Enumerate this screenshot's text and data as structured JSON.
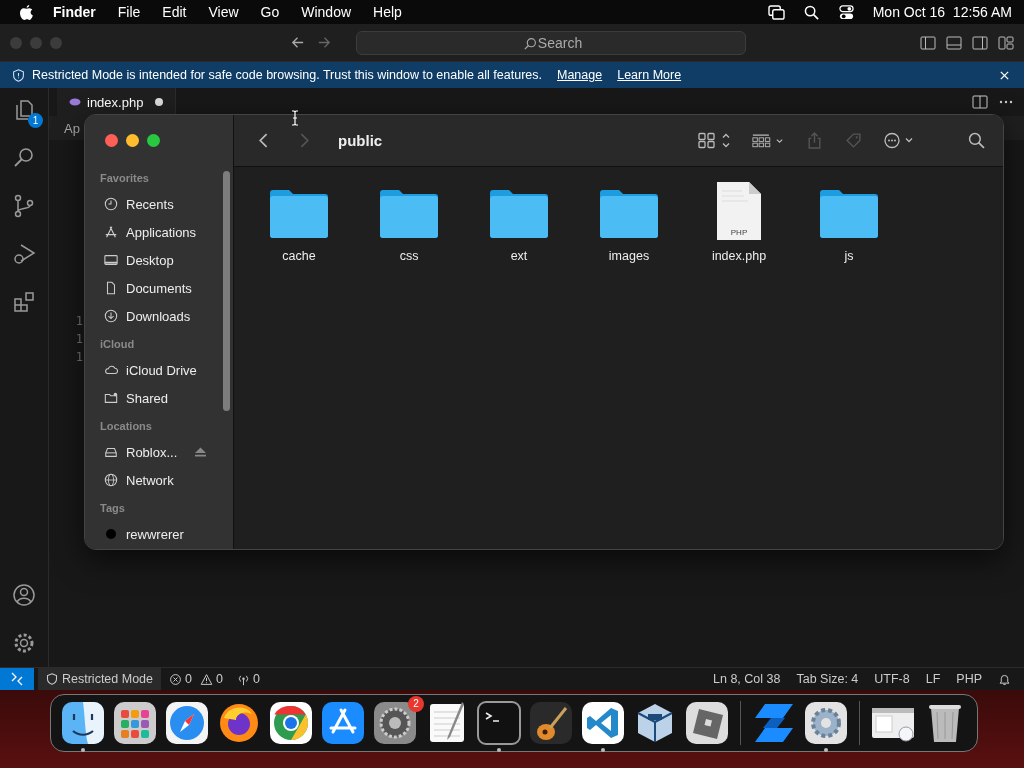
{
  "menu_bar": {
    "app_name": "Finder",
    "menus": [
      "File",
      "Edit",
      "View",
      "Go",
      "Window",
      "Help"
    ],
    "clock": "Mon Oct 16  12:56 AM"
  },
  "editor_window": {
    "search": {
      "placeholder": "Search"
    },
    "banner": {
      "message": "Restricted Mode is intended for safe code browsing. Trust this window to enable all features.",
      "links": [
        "Manage",
        "Learn More"
      ]
    },
    "explorer_badge": "1",
    "tab": {
      "label": "index.php",
      "modified": true
    },
    "editor_text": "Ap",
    "line_numbers": [
      "1",
      "1",
      "1"
    ]
  },
  "status_bar": {
    "mode": "Restricted Mode",
    "errors": "0",
    "warnings": "0",
    "ports": "0",
    "items": [
      "Ln 8, Col 38",
      "Tab Size: 4",
      "UTF-8",
      "LF",
      "PHP"
    ]
  },
  "finder": {
    "title": "public",
    "sidebar": [
      {
        "heading": "Favorites",
        "items": [
          {
            "label": "Recents",
            "kind": "recents",
            "selected": false
          },
          {
            "label": "Applications",
            "kind": "applications",
            "selected": false
          },
          {
            "label": "Desktop",
            "kind": "desktop",
            "selected": false
          },
          {
            "label": "Documents",
            "kind": "documents",
            "selected": false
          },
          {
            "label": "Downloads",
            "kind": "downloads",
            "selected": false
          }
        ]
      },
      {
        "heading": "iCloud",
        "items": [
          {
            "label": "iCloud Drive",
            "kind": "cloud",
            "selected": false
          },
          {
            "label": "Shared",
            "kind": "shared",
            "selected": false
          }
        ]
      },
      {
        "heading": "Locations",
        "items": [
          {
            "label": "Roblox...",
            "kind": "drive",
            "selected": false,
            "ejectable": true
          },
          {
            "label": "Network",
            "kind": "network",
            "selected": false
          }
        ]
      },
      {
        "heading": "Tags",
        "items": [
          {
            "label": "rewwrerer",
            "kind": "tag",
            "selected": false,
            "color": "#000000"
          }
        ]
      }
    ],
    "files": [
      {
        "name": "cache",
        "kind": "folder"
      },
      {
        "name": "css",
        "kind": "folder"
      },
      {
        "name": "ext",
        "kind": "folder"
      },
      {
        "name": "images",
        "kind": "folder"
      },
      {
        "name": "index.php",
        "kind": "php",
        "badge": "PHP"
      },
      {
        "name": "js",
        "kind": "folder"
      }
    ]
  },
  "dock": {
    "items": [
      {
        "kind": "finder",
        "running": true
      },
      {
        "kind": "launchpad",
        "running": false
      },
      {
        "kind": "safari",
        "running": false
      },
      {
        "kind": "firefox",
        "running": false
      },
      {
        "kind": "chrome",
        "running": false
      },
      {
        "kind": "appstore",
        "running": false
      },
      {
        "kind": "settings",
        "running": false,
        "badge": "2"
      },
      {
        "kind": "textedit",
        "running": false
      },
      {
        "kind": "terminal",
        "running": true
      },
      {
        "kind": "garageband",
        "running": false
      },
      {
        "kind": "vscode",
        "running": true
      },
      {
        "kind": "virtualbox",
        "running": false
      },
      {
        "kind": "roblox",
        "running": false,
        "separator_after": true
      },
      {
        "kind": "studio",
        "running": false
      },
      {
        "kind": "utility",
        "running": true,
        "separator_after": true
      },
      {
        "kind": "screenshot",
        "running": false
      },
      {
        "kind": "trash",
        "running": false
      }
    ]
  }
}
